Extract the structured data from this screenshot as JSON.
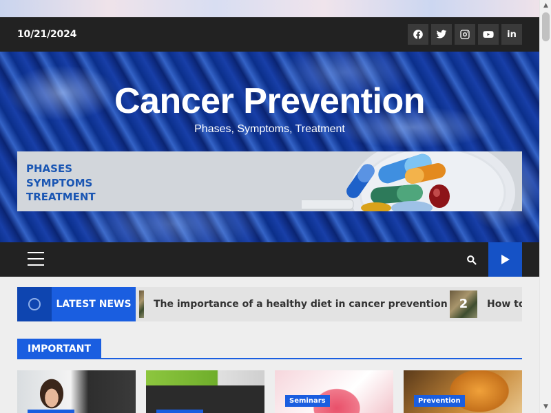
{
  "topbar": {
    "date": "10/21/2024",
    "socials": [
      {
        "icon": "facebook-icon"
      },
      {
        "icon": "twitter-icon"
      },
      {
        "icon": "instagram-icon"
      },
      {
        "icon": "youtube-icon"
      },
      {
        "icon": "linkedin-icon",
        "glyph": "in"
      }
    ]
  },
  "header": {
    "title": "Cancer Prevention",
    "tagline": "Phases, Symptoms, Treatment",
    "banner_lines": [
      "PHASES",
      "SYMPTOMS",
      "TREATMENT"
    ]
  },
  "nav": {
    "menu_icon": "hamburger-icon",
    "search_icon": "search-icon",
    "play_icon": "play-icon"
  },
  "ticker": {
    "label": "LATEST NEWS",
    "items": [
      {
        "text": "The importance of a healthy diet in cancer prevention"
      },
      {
        "number": "2",
        "text": "How to"
      }
    ]
  },
  "important": {
    "label": "IMPORTANT",
    "cards": [
      {
        "category": ""
      },
      {
        "category": ""
      },
      {
        "category": "Seminars"
      },
      {
        "category": "Prevention"
      }
    ]
  },
  "colors": {
    "accent": "#1a5ee0",
    "dark_bar": "#222222",
    "banner_text": "#1a56b3"
  }
}
